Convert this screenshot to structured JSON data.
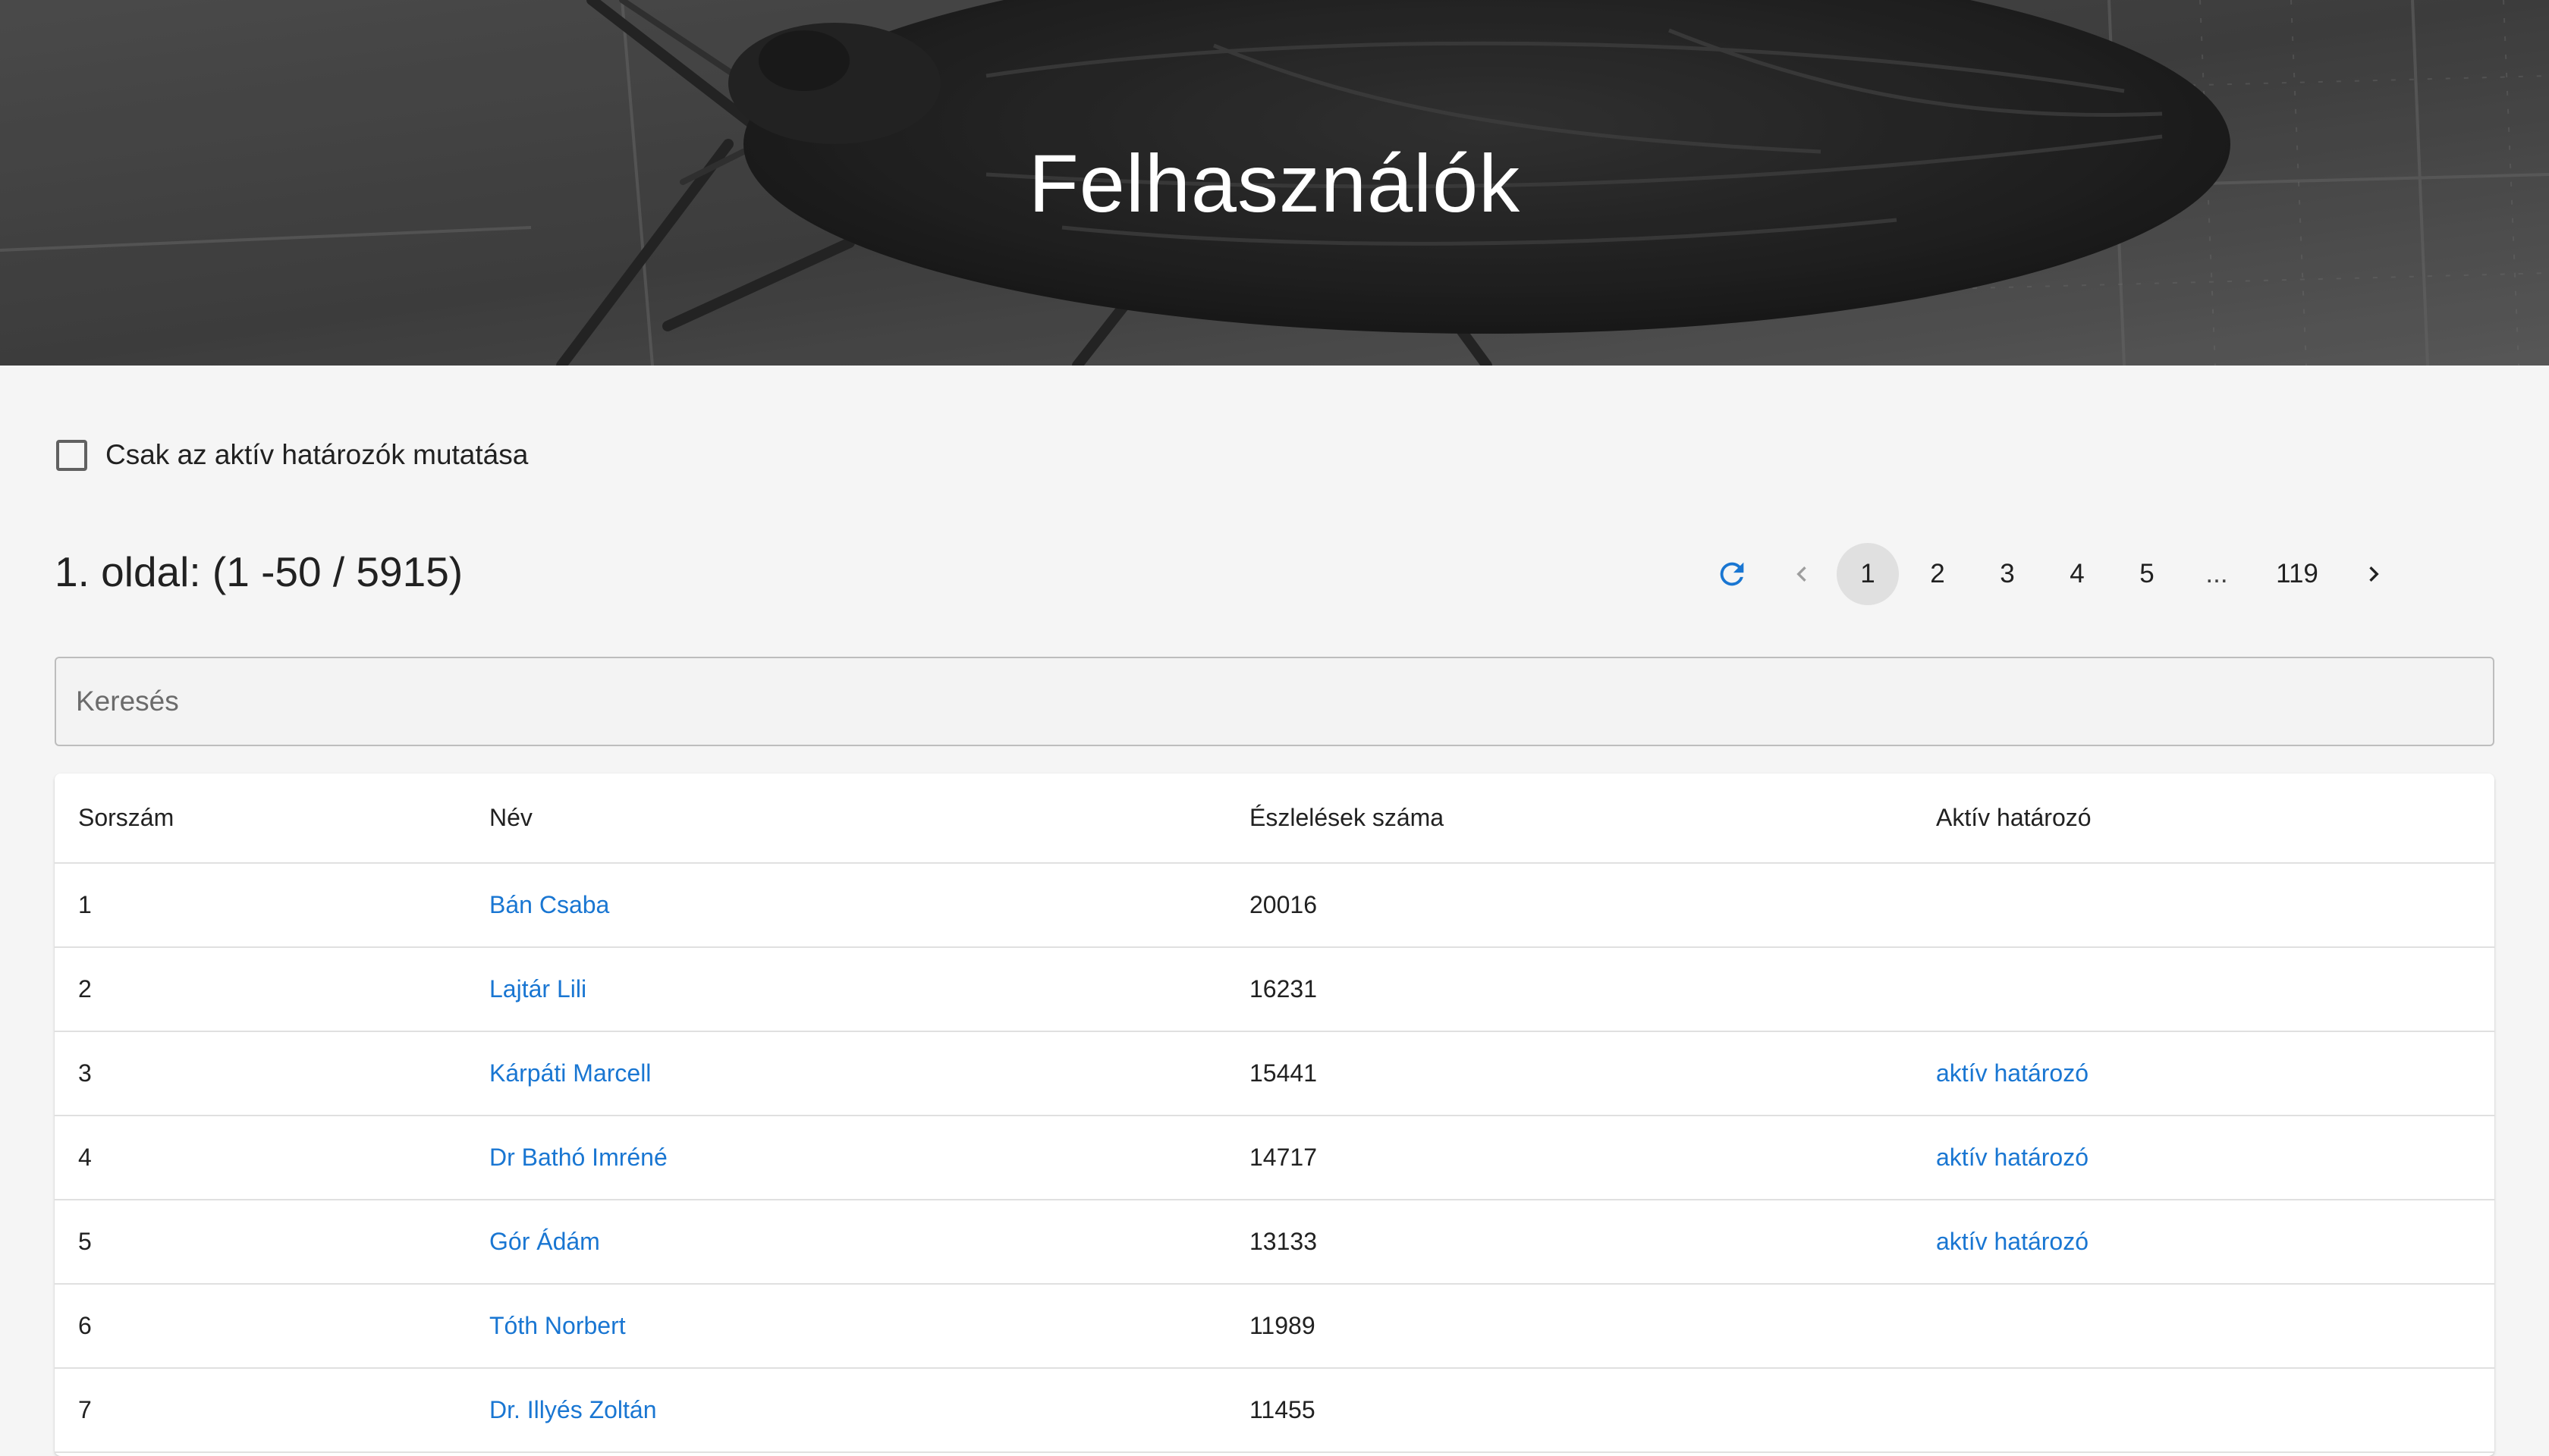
{
  "header": {
    "title": "Felhasználók"
  },
  "filter": {
    "active_only_label": "Csak az aktív határozók mutatása",
    "checked": false
  },
  "page_heading": "1. oldal: (1 -50 / 5915)",
  "pagination": {
    "refresh_icon": "refresh-icon",
    "prev_icon": "chevron-left-icon",
    "next_icon": "chevron-right-icon",
    "pages": [
      "1",
      "2",
      "3",
      "4",
      "5"
    ],
    "ellipsis": "...",
    "last_page": "119",
    "current": "1"
  },
  "search": {
    "placeholder": "Keresés",
    "value": ""
  },
  "table": {
    "columns": [
      "Sorszám",
      "Név",
      "Észlelések száma",
      "Aktív határozó"
    ],
    "rows": [
      {
        "index": "1",
        "name": "Bán Csaba",
        "observations": "20016",
        "active": ""
      },
      {
        "index": "2",
        "name": "Lajtár Lili",
        "observations": "16231",
        "active": ""
      },
      {
        "index": "3",
        "name": "Kárpáti Marcell",
        "observations": "15441",
        "active": "aktív határozó"
      },
      {
        "index": "4",
        "name": "Dr Bathó Imréné",
        "observations": "14717",
        "active": "aktív határozó"
      },
      {
        "index": "5",
        "name": "Gór Ádám",
        "observations": "13133",
        "active": "aktív határozó"
      },
      {
        "index": "6",
        "name": "Tóth Norbert",
        "observations": "11989",
        "active": ""
      },
      {
        "index": "7",
        "name": "Dr. Illyés Zoltán",
        "observations": "11455",
        "active": ""
      }
    ]
  },
  "colors": {
    "link": "#1976d2",
    "refresh": "#1976d2",
    "active_page_bg": "#e0e0e0",
    "background": "#f5f5f5"
  }
}
